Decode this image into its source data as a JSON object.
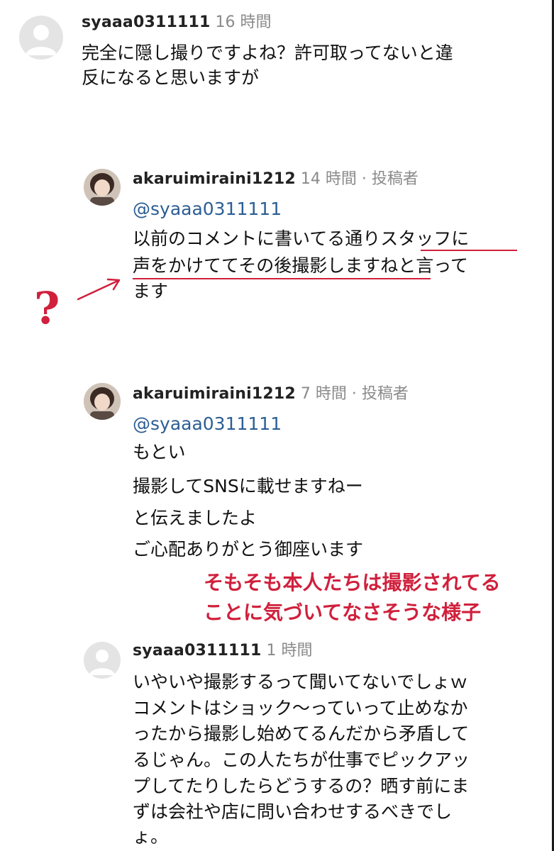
{
  "comments": [
    {
      "username": "syaaa0311111",
      "time": "16 時間",
      "lines": [
        "完全に隠し撮りですよね？許可取ってないと違",
        "反になると思いますが"
      ]
    },
    {
      "username": "akaruimiraini1212",
      "time": "14 時間",
      "separator": "·",
      "author_tag": "投稿者",
      "mention": "@syaaa0311111",
      "lines": [
        "以前のコメントに書いてる通りスタッフに",
        "声をかけててその後撮影しますねと言って",
        "ます"
      ]
    },
    {
      "username": "akaruimiraini1212",
      "time": "7 時間",
      "separator": "·",
      "author_tag": "投稿者",
      "mention": "@syaaa0311111",
      "lines": [
        "もとい",
        "撮影してSNSに載せますねー",
        "と伝えましたよ",
        "ご心配ありがとう御座います"
      ]
    },
    {
      "username": "syaaa0311111",
      "time": "1 時間",
      "lines": [
        "いやいや撮影するって聞いてないでしょｗ",
        "コメントはショック〜っていって止めなか",
        "ったから撮影し始めてるんだから矛盾して",
        "るじゃん。この人たちが仕事でピックアッ",
        "プしてたりしたらどうするの？晒す前にま",
        "ずは会社や店に問い合わせするべきでし",
        "ょ。"
      ]
    }
  ],
  "annotations": {
    "question_mark": "?",
    "note_lines": [
      "そもそも本人たちは撮影されてる",
      "ことに気づいてなさそうな様子"
    ],
    "accent_color": "#d0203c"
  }
}
